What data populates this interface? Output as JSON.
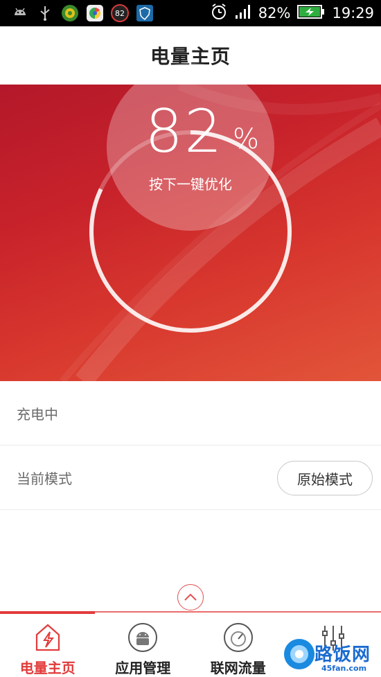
{
  "status_bar": {
    "icons": [
      "android-icon",
      "usb-icon",
      "app-icon-green",
      "chrome-icon",
      "badge-82-icon",
      "shield-icon"
    ],
    "badge_value": "82",
    "battery_percent": "82%",
    "time": "19:29"
  },
  "header": {
    "title": "电量主页"
  },
  "hero": {
    "value": "82",
    "unit": "%",
    "hint": "按下一键优化",
    "battery_level": 0.82,
    "colors": {
      "top": "#b4182a",
      "bottom": "#e2553a"
    }
  },
  "rows": {
    "charging_label": "充电中",
    "mode_label": "当前模式",
    "mode_button_label": "原始模式"
  },
  "nav": {
    "items": [
      {
        "label": "电量主页",
        "icon": "battery-home-icon",
        "active": true
      },
      {
        "label": "应用管理",
        "icon": "android-app-icon",
        "active": false
      },
      {
        "label": "联网流量",
        "icon": "speedometer-icon",
        "active": false
      },
      {
        "label": "",
        "icon": "sliders-icon",
        "active": false
      }
    ],
    "accent_color": "#e23b3b"
  },
  "watermark": {
    "text": "路饭网",
    "subtext": "45fan.com"
  }
}
